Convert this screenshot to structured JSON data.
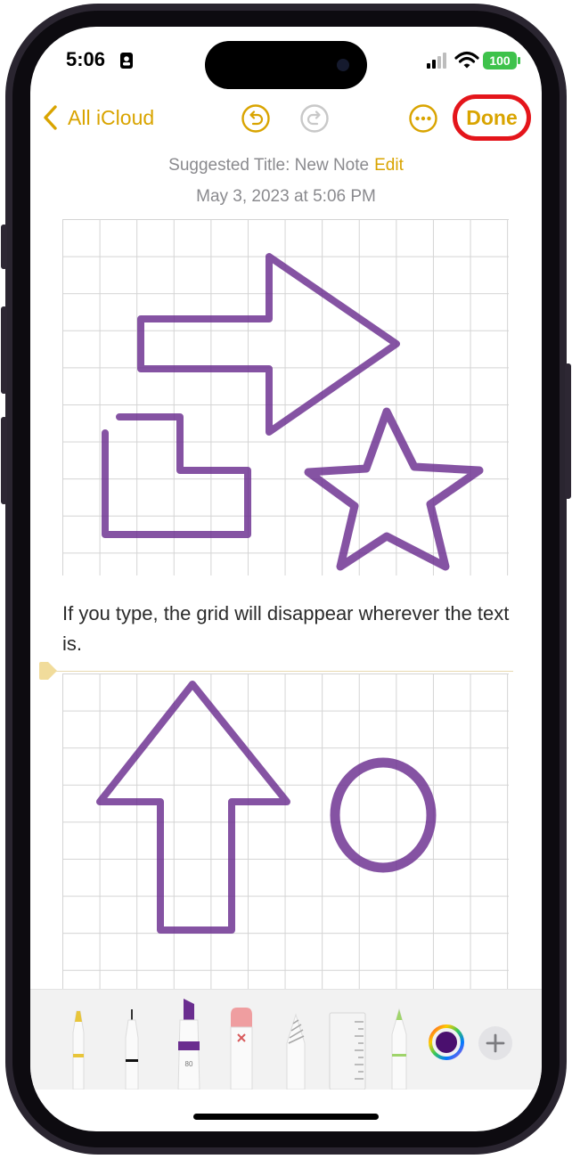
{
  "status": {
    "time": "5:06",
    "battery": "100"
  },
  "nav": {
    "back_label": "All iCloud",
    "done_label": "Done"
  },
  "header": {
    "suggested_title": "Suggested Title: New Note",
    "edit_label": "Edit",
    "date": "May 3, 2023 at 5:06 PM"
  },
  "note": {
    "text": "If you type, the grid will disappear wherever the text is."
  },
  "toolbar": {
    "marker_label": "80"
  },
  "colors": {
    "accent": "#d9a400",
    "ink": "#6a2d8f",
    "highlight_ring": "#e4151b",
    "battery": "#3ec24b"
  },
  "icons": [
    "chevron-left-icon",
    "undo-icon",
    "redo-icon",
    "more-icon",
    "wifi-icon",
    "signal-icon",
    "person-badge-icon",
    "plus-icon"
  ]
}
